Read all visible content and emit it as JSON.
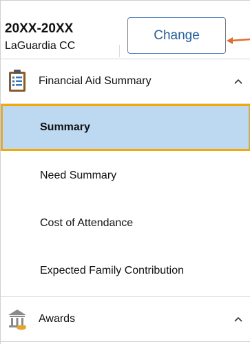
{
  "header": {
    "year": "20XX-20XX",
    "school": "LaGuardia CC",
    "change_label": "Change"
  },
  "sections": {
    "financial_aid": {
      "label": "Financial Aid Summary",
      "icon": "clipboard-icon",
      "expanded": true
    },
    "awards": {
      "label": "Awards",
      "icon": "bank-icon",
      "expanded": true
    }
  },
  "nav": {
    "items": [
      {
        "label": "Summary",
        "selected": true
      },
      {
        "label": "Need Summary",
        "selected": false
      },
      {
        "label": "Cost of Attendance",
        "selected": false
      },
      {
        "label": "Expected Family Contribution",
        "selected": false
      }
    ]
  },
  "colors": {
    "accent": "#1f5fa8",
    "selected_bg": "#bdd9f2",
    "selected_border": "#f5a800",
    "callout_arrow": "#e8692a"
  }
}
